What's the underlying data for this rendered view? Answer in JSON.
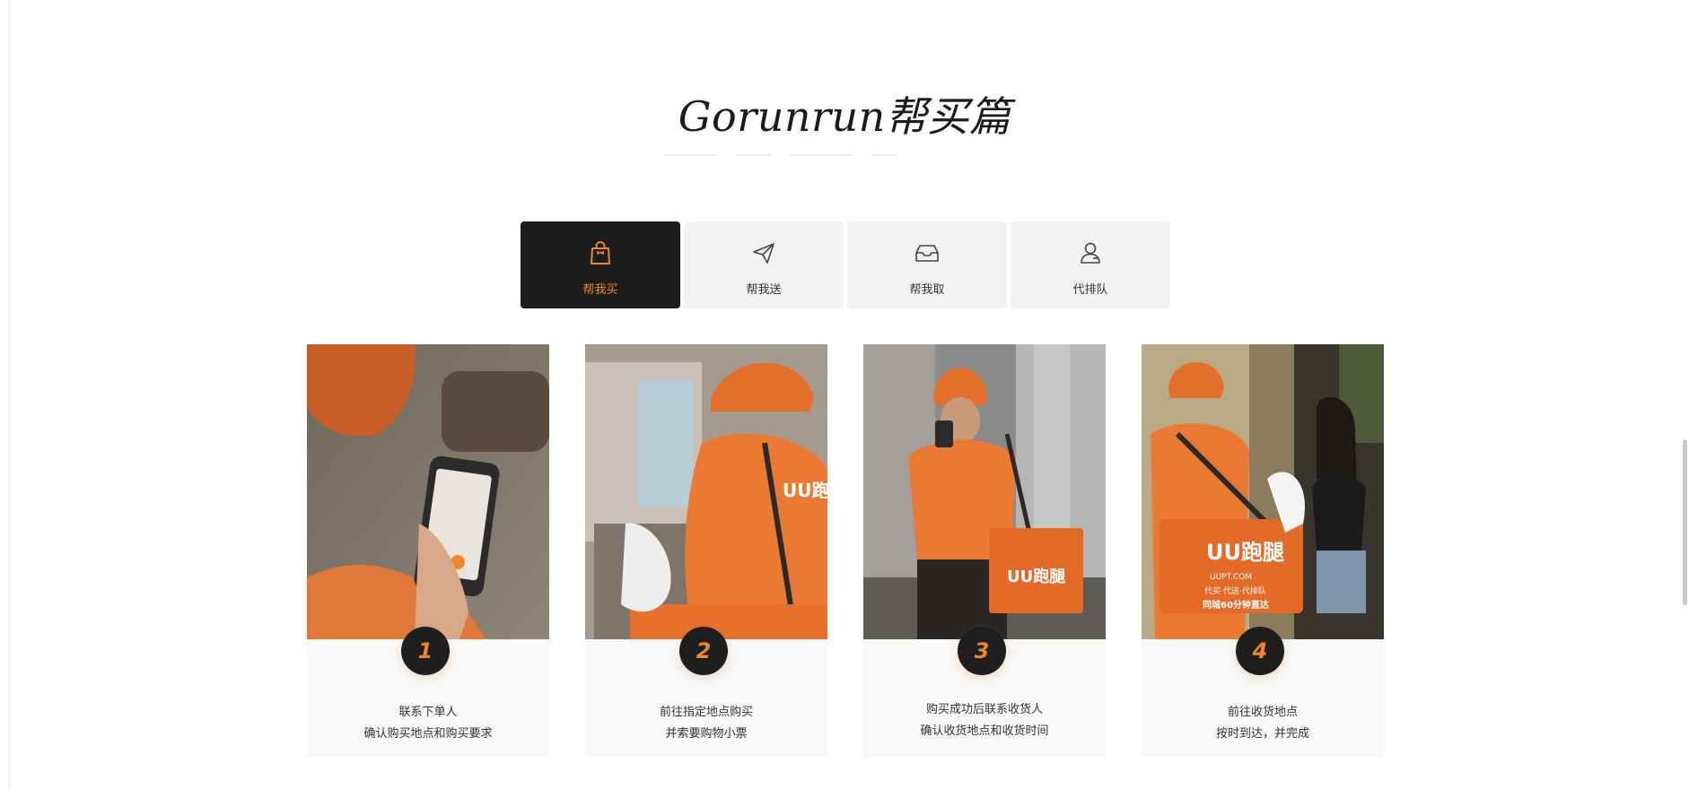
{
  "section": {
    "title": "Gorunrun帮买篇"
  },
  "tabs": [
    {
      "label": "帮我买",
      "icon": "shopping-bag-icon",
      "active": true
    },
    {
      "label": "帮我送",
      "icon": "paper-plane-icon",
      "active": false
    },
    {
      "label": "帮我取",
      "icon": "inbox-tray-icon",
      "active": false
    },
    {
      "label": "代排队",
      "icon": "person-icon",
      "active": false
    }
  ],
  "steps": [
    {
      "number": "1",
      "line1": "联系下单人",
      "line2": "确认购买地点和购买要求"
    },
    {
      "number": "2",
      "line1": "前往指定地点购买",
      "line2": "并索要购物小票"
    },
    {
      "number": "3",
      "line1": "购买成功后联系收货人",
      "line2": "确认收货地点和收货时间"
    },
    {
      "number": "4",
      "line1": "前往收货地点",
      "line2": "按时到达，并完成"
    }
  ],
  "photo_text": {
    "brand": "UU跑腿",
    "services": "代买·代送·代排队",
    "site": "UUPT.COM",
    "promise": "同城60分钟直达"
  },
  "colors": {
    "accent": "#f0862a",
    "dark": "#1c1c1c",
    "tab_bg": "#f2f2f2"
  }
}
